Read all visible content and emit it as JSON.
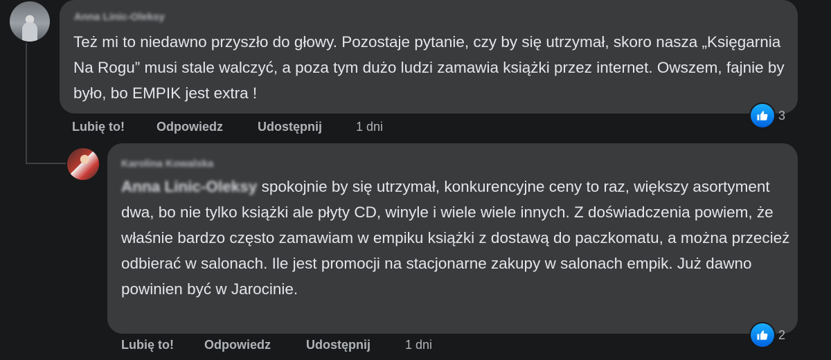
{
  "comments": [
    {
      "author": "Anna Linic-Oleksy",
      "text": "Też mi to niedawno przyszło do głowy. Pozostaje pytanie, czy by się utrzymał, skoro nasza „Księgarnia Na Rogu” musi stale walczyć, a poza tym dużo ludzi zamawia książki przez internet. Owszem, fajnie by było, bo EMPIK jest extra !",
      "reaction_icon": "like-icon",
      "reaction_count": "3",
      "actions": {
        "like": "Lubię to!",
        "reply": "Odpowiedz",
        "share": "Udostępnij",
        "time": "1 dni"
      }
    }
  ],
  "replies": [
    {
      "author": "Karolina Kowalska",
      "mention": "Anna Linic-Oleksy",
      "text": " spokojnie by się utrzymał, konkurencyjne ceny to raz, większy asortyment dwa, bo nie tylko książki ale płyty CD, winyle i wiele wiele innych. Z doświadczenia powiem, że właśnie bardzo często zamawiam w empiku książki z dostawą do paczkomatu, a można przecież odbierać w salonach. Ile jest promocji na stacjonarne zakupy w salonach empik. Już dawno powinien być w Jarocinie.",
      "reaction_icon": "like-icon",
      "reaction_count": "2",
      "actions": {
        "like": "Lubię to!",
        "reply": "Odpowiedz",
        "share": "Udostępnij",
        "time": "1 dni"
      }
    }
  ],
  "colors": {
    "background": "#18191a",
    "bubble": "#3a3b3c",
    "text": "#e4e6eb",
    "muted": "#b0b3b8",
    "like_blue": "#1877f2"
  }
}
